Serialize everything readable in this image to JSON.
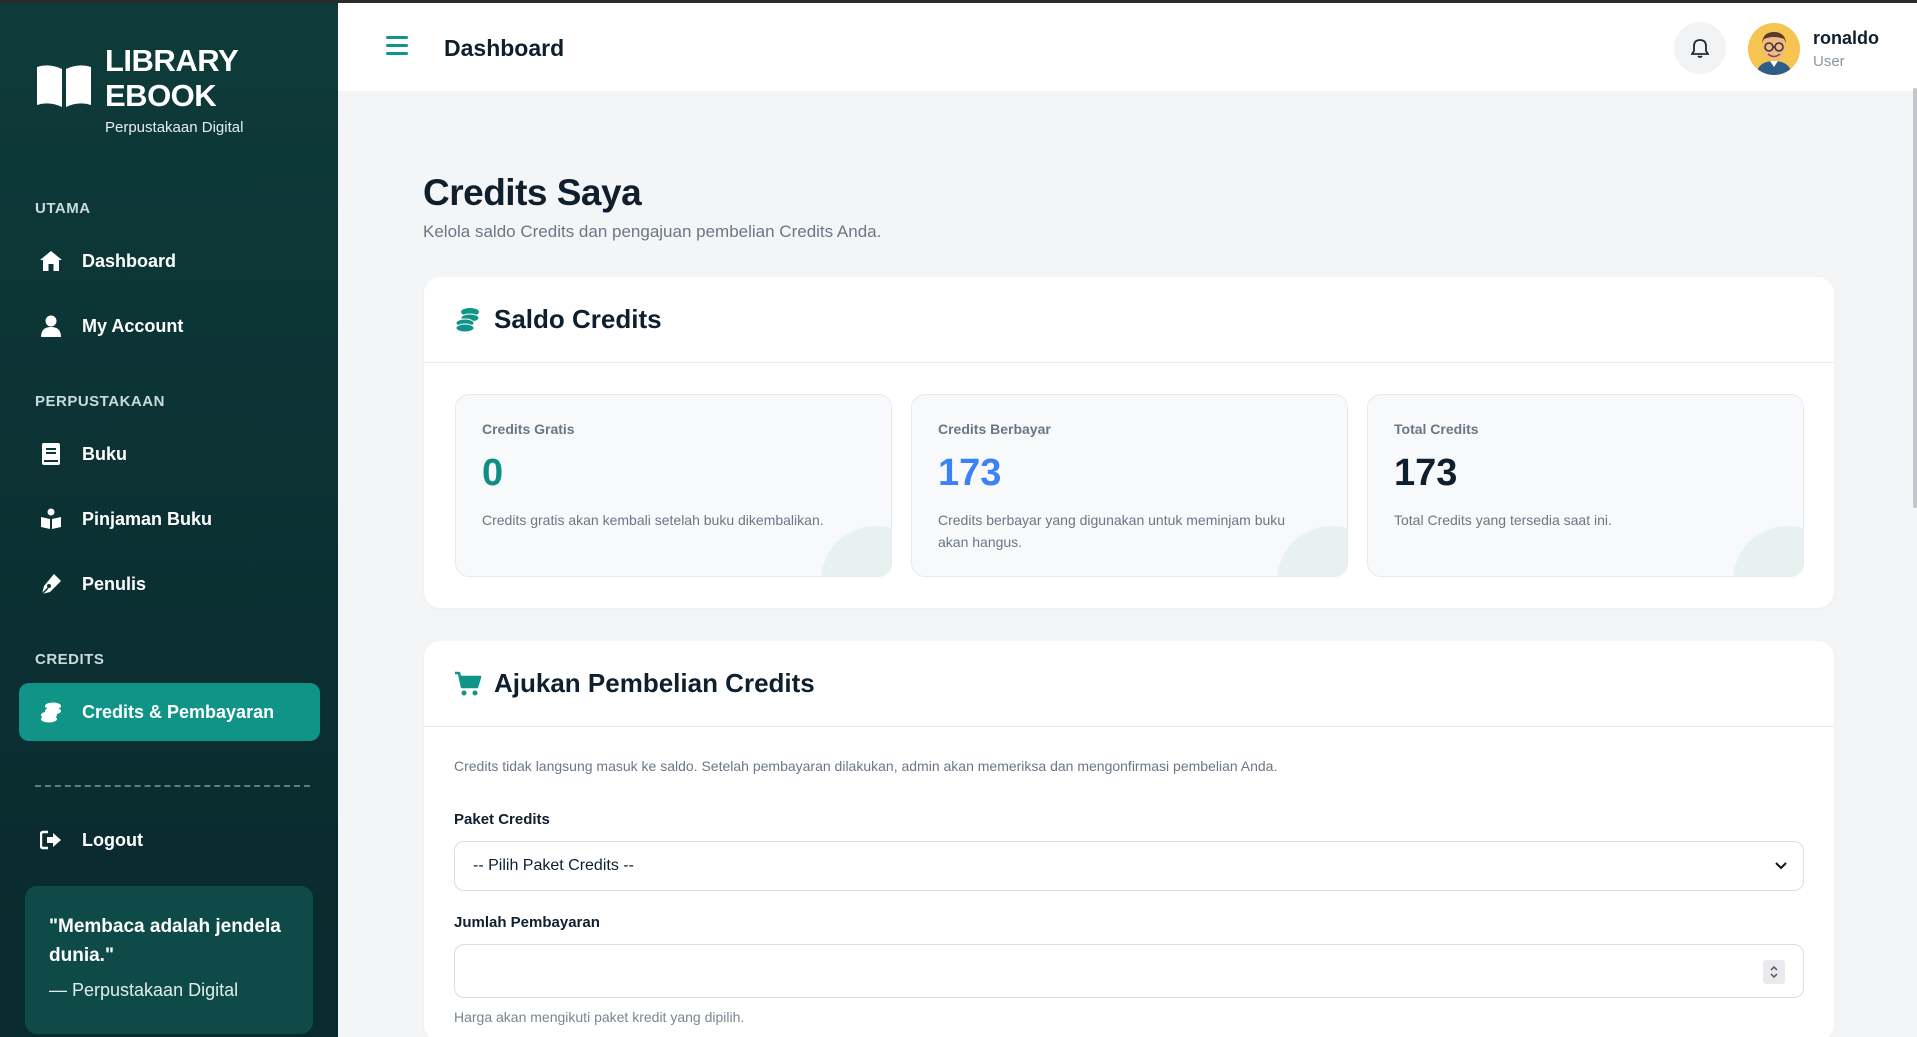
{
  "brand": {
    "title": "LIBRARY EBOOK",
    "subtitle": "Perpustakaan Digital"
  },
  "sidebar": {
    "sections": [
      {
        "label": "UTAMA"
      },
      {
        "label": "PERPUSTAKAAN"
      },
      {
        "label": "CREDITS"
      }
    ],
    "items": [
      {
        "label": "Dashboard",
        "icon": "home-icon"
      },
      {
        "label": "My Account",
        "icon": "user-icon"
      },
      {
        "label": "Buku",
        "icon": "book-icon"
      },
      {
        "label": "Pinjaman Buku",
        "icon": "book-reader-icon"
      },
      {
        "label": "Penulis",
        "icon": "pen-icon"
      },
      {
        "label": "Credits & Pembayaran",
        "icon": "coins-icon",
        "active": true
      },
      {
        "label": "Logout",
        "icon": "logout-icon"
      }
    ],
    "quote": {
      "text": "\"Membaca adalah jendela dunia.\"",
      "author": "— Perpustakaan Digital"
    }
  },
  "header": {
    "title": "Dashboard",
    "user": {
      "name": "ronaldo",
      "role": "User"
    }
  },
  "page": {
    "title": "Credits Saya",
    "subtitle": "Kelola saldo Credits dan pengajuan pembelian Credits Anda."
  },
  "balance": {
    "title": "Saldo Credits",
    "stats": [
      {
        "label": "Credits Gratis",
        "value": "0",
        "desc": "Credits gratis akan kembali setelah buku dikembalikan.",
        "color": "#0f8f84"
      },
      {
        "label": "Credits Berbayar",
        "value": "173",
        "desc": "Credits berbayar yang digunakan untuk meminjam buku akan hangus.",
        "color": "#3b82f6"
      },
      {
        "label": "Total Credits",
        "value": "173",
        "desc": "Total Credits yang tersedia saat ini.",
        "color": "#0f1f2e"
      }
    ]
  },
  "purchase": {
    "title": "Ajukan Pembelian Credits",
    "info": "Credits tidak langsung masuk ke saldo. Setelah pembayaran dilakukan, admin akan memeriksa dan mengonfirmasi pembelian Anda.",
    "package_label": "Paket Credits",
    "package_selected": "-- Pilih Paket Credits --",
    "amount_label": "Jumlah Pembayaran",
    "amount_value": "",
    "amount_hint": "Harga akan mengikuti paket kredit yang dipilih."
  },
  "colors": {
    "accent": "#109488",
    "sidebar_bg": "#0b2f32",
    "blue": "#3b82f6"
  }
}
